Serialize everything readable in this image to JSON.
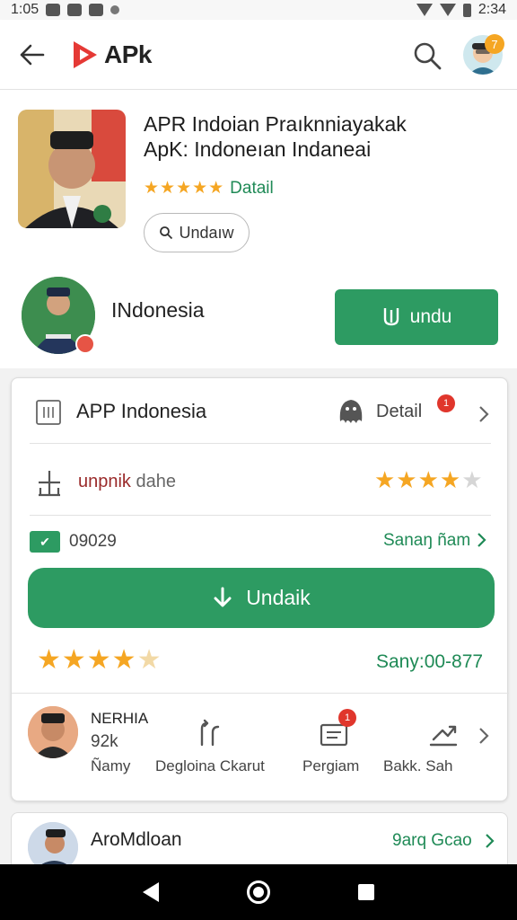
{
  "status_bar": {
    "time": "1:05",
    "clock_right": "2:34"
  },
  "app_bar": {
    "title": "APk",
    "notification_count": "7"
  },
  "hero": {
    "title_line1": "APR Indoian Praıknniayakak",
    "title_line2": "ApK: Indoneıan Indaneai",
    "stars": "★★★★★",
    "detail_link": "Datail",
    "chip_label": "Undaıw",
    "developer_name": "INdonesia",
    "install_label": "undu"
  },
  "card": {
    "row1": {
      "title": "APP Indonesia",
      "detail": "Detail",
      "badge": "1"
    },
    "row2": {
      "text_red": "unpnik",
      "text_grey": " dahe",
      "stars_filled": "★★★★",
      "stars_empty": "★"
    },
    "row3": {
      "check": "✔",
      "code": "09029",
      "link": "Sanaŋ ñam"
    },
    "download_label": "Undaik",
    "row5": {
      "stars_filled": "★★★★",
      "stars_empty": "★",
      "size": "Sany:00-877"
    },
    "author": {
      "name": "NERHIA",
      "count": "92k",
      "caption": "Ñamy"
    },
    "stats": [
      {
        "label": "Degloina Ckarut"
      },
      {
        "label": "Pergiam",
        "badge": "1"
      },
      {
        "label": "Bakk. Sah"
      }
    ]
  },
  "card2": {
    "name": "AroMdloan",
    "link": "9arq Gcao"
  },
  "colors": {
    "accent_green": "#2d9b62",
    "link_green": "#1f8a56",
    "star": "#f5a623",
    "badge_red": "#e0362c"
  }
}
